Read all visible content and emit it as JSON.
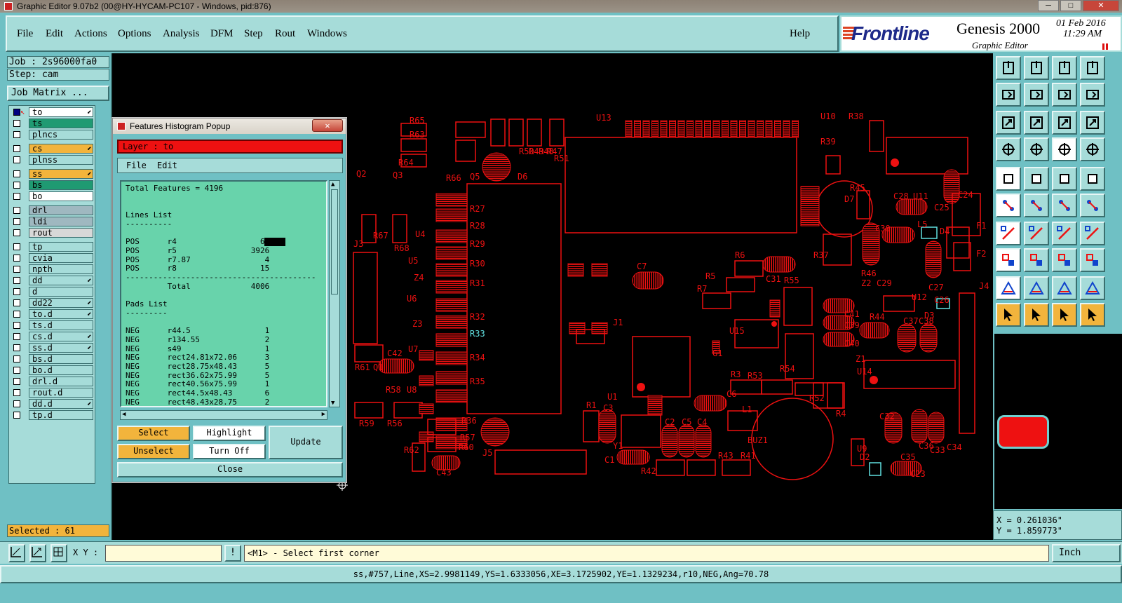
{
  "window": {
    "title": "Graphic Editor 9.07b2 (00@HY-HYCAM-PC107 - Windows, pid:876)"
  },
  "menubar": {
    "items": [
      "File",
      "Edit",
      "Actions",
      "Options",
      "Analysis",
      "DFM",
      "Step",
      "Rout",
      "Windows"
    ],
    "help": "Help"
  },
  "branding": {
    "company": "Frontline",
    "product": "Genesis 2000",
    "subtitle": "Graphic Editor",
    "date": "01 Feb 2016",
    "time": "11:29 AM"
  },
  "job": {
    "job_text": "Job : 2s96000fa0",
    "step_text": "Step: cam",
    "matrix_label": "Job Matrix ..."
  },
  "layers": [
    {
      "name": "to",
      "color": "#ffffff",
      "active": true,
      "mark": "⬋"
    },
    {
      "name": "ts",
      "color": "#1f9a72",
      "active": false,
      "mark": ""
    },
    {
      "name": "plncs",
      "color": "#a6dcd9",
      "active": false,
      "mark": ""
    },
    {
      "name": "cs",
      "color": "#f2b43c",
      "active": false,
      "mark": "⬋"
    },
    {
      "name": "plnss",
      "color": "#a6dcd9",
      "active": false,
      "mark": ""
    },
    {
      "name": "ss",
      "color": "#f2b43c",
      "active": false,
      "mark": "⬋"
    },
    {
      "name": "bs",
      "color": "#1f9a72",
      "active": false,
      "mark": ""
    },
    {
      "name": "bo",
      "color": "#ffffff",
      "active": false,
      "mark": ""
    },
    {
      "name": "drl",
      "color": "#9fb8c0",
      "active": false,
      "mark": ""
    },
    {
      "name": "ldi",
      "color": "#9fb8c0",
      "active": false,
      "mark": ""
    },
    {
      "name": "rout",
      "color": "#d8d8d8",
      "active": false,
      "mark": ""
    },
    {
      "name": "tp",
      "color": "#a6dcd9",
      "active": false,
      "mark": ""
    },
    {
      "name": "cvia",
      "color": "#a6dcd9",
      "active": false,
      "mark": ""
    },
    {
      "name": "npth",
      "color": "#a6dcd9",
      "active": false,
      "mark": ""
    },
    {
      "name": "dd",
      "color": "#a6dcd9",
      "active": false,
      "mark": "⬋"
    },
    {
      "name": "d",
      "color": "#a6dcd9",
      "active": false,
      "mark": ""
    },
    {
      "name": "dd22",
      "color": "#a6dcd9",
      "active": false,
      "mark": "⬋"
    },
    {
      "name": "to.d",
      "color": "#a6dcd9",
      "active": false,
      "mark": "⬋"
    },
    {
      "name": "ts.d",
      "color": "#a6dcd9",
      "active": false,
      "mark": ""
    },
    {
      "name": "cs.d",
      "color": "#a6dcd9",
      "active": false,
      "mark": "⬋"
    },
    {
      "name": "ss.d",
      "color": "#a6dcd9",
      "active": false,
      "mark": "⬋"
    },
    {
      "name": "bs.d",
      "color": "#a6dcd9",
      "active": false,
      "mark": ""
    },
    {
      "name": "bo.d",
      "color": "#a6dcd9",
      "active": false,
      "mark": ""
    },
    {
      "name": "drl.d",
      "color": "#a6dcd9",
      "active": false,
      "mark": ""
    },
    {
      "name": "rout.d",
      "color": "#a6dcd9",
      "active": false,
      "mark": ""
    },
    {
      "name": "dd.d",
      "color": "#a6dcd9",
      "active": false,
      "mark": "⬋"
    },
    {
      "name": "tp.d",
      "color": "#a6dcd9",
      "active": false,
      "mark": ""
    }
  ],
  "selected_text": "Selected : 61",
  "popup": {
    "title": "Features Histogram Popup",
    "close_x": "✕",
    "layer_label": "Layer :  to",
    "menu": [
      "File",
      "Edit"
    ],
    "lines": [
      "Total Features = 4196",
      "",
      "",
      "Lines List",
      "----------",
      "",
      "POS      r4                  61",
      "POS      r5                3926",
      "POS      r7.87                4",
      "POS      r8                  15",
      "-----------------------------------------",
      "         Total             4006",
      "",
      "Pads List",
      "---------",
      "",
      "NEG      r44.5                1",
      "NEG      r134.55              2",
      "NEG      s49                  1",
      "NEG      rect24.81x72.06      3",
      "NEG      rect28.75x48.43      5",
      "NEG      rect36.62x75.99      5",
      "NEG      rect40.56x75.99      1",
      "NEG      rect44.5x48.43       6",
      "NEG      rect48.43x28.75      2"
    ],
    "buttons": {
      "select": "Select",
      "highlight": "Highlight",
      "update": "Update",
      "unselect": "Unselect",
      "turn_off": "Turn Off",
      "close": "Close"
    }
  },
  "pcb": {
    "labels": [
      "U13",
      "U10",
      "R38",
      "R39",
      "Q2",
      "Q3",
      "R67",
      "U4",
      "R68",
      "U5",
      "Z4",
      "U6",
      "Z3",
      "U7",
      "J3",
      "R61",
      "Q1",
      "C42",
      "R58",
      "U8",
      "R59",
      "R56",
      "R62",
      "C43",
      "J5",
      "R63",
      "R65",
      "R64",
      "R66",
      "Q5",
      "R50",
      "R49",
      "R48",
      "R47",
      "R51",
      "D6",
      "R27",
      "R28",
      "R29",
      "R30",
      "R31",
      "R32",
      "R33",
      "R34",
      "R35",
      "R36",
      "R57",
      "R60",
      "C7",
      "R6",
      "R5",
      "R7",
      "C31",
      "R55",
      "R37",
      "R45",
      "D7",
      "C28",
      "U11",
      "C24",
      "C25",
      "C30",
      "L5",
      "D4",
      "F1",
      "F2",
      "R46",
      "Z2",
      "C29",
      "C27",
      "C26",
      "U12",
      "J4",
      "C41",
      "C39",
      "C40",
      "R44",
      "C37",
      "C38",
      "D3",
      "Z1",
      "U14",
      "J1",
      "U15",
      "G1",
      "R3",
      "R53",
      "R54",
      "R1",
      "C3",
      "U1",
      "Y1",
      "C1",
      "C2",
      "C5",
      "C4",
      "C6",
      "L1",
      "R42",
      "R43",
      "R41",
      "BUZ1",
      "R52",
      "R4",
      "C32",
      "C36",
      "C33",
      "C34",
      "U9",
      "D2",
      "C35",
      "C23"
    ],
    "colors": {
      "trace": "#ee1111",
      "highlight": "#60e0e0",
      "background": "#000000"
    }
  },
  "coords": {
    "x_text": "X = 0.261036\"",
    "y_text": "Y = 1.859773\""
  },
  "command": {
    "xy_label": "X Y :",
    "xy_value": "",
    "excl": "!",
    "prompt": "<M1> - Select first corner",
    "unit": "Inch"
  },
  "status_text": "ss,#757,Line,XS=2.9981149,YS=1.6333056,XE=3.1725902,YE=1.1329234,r10,NEG,Ang=70.78"
}
